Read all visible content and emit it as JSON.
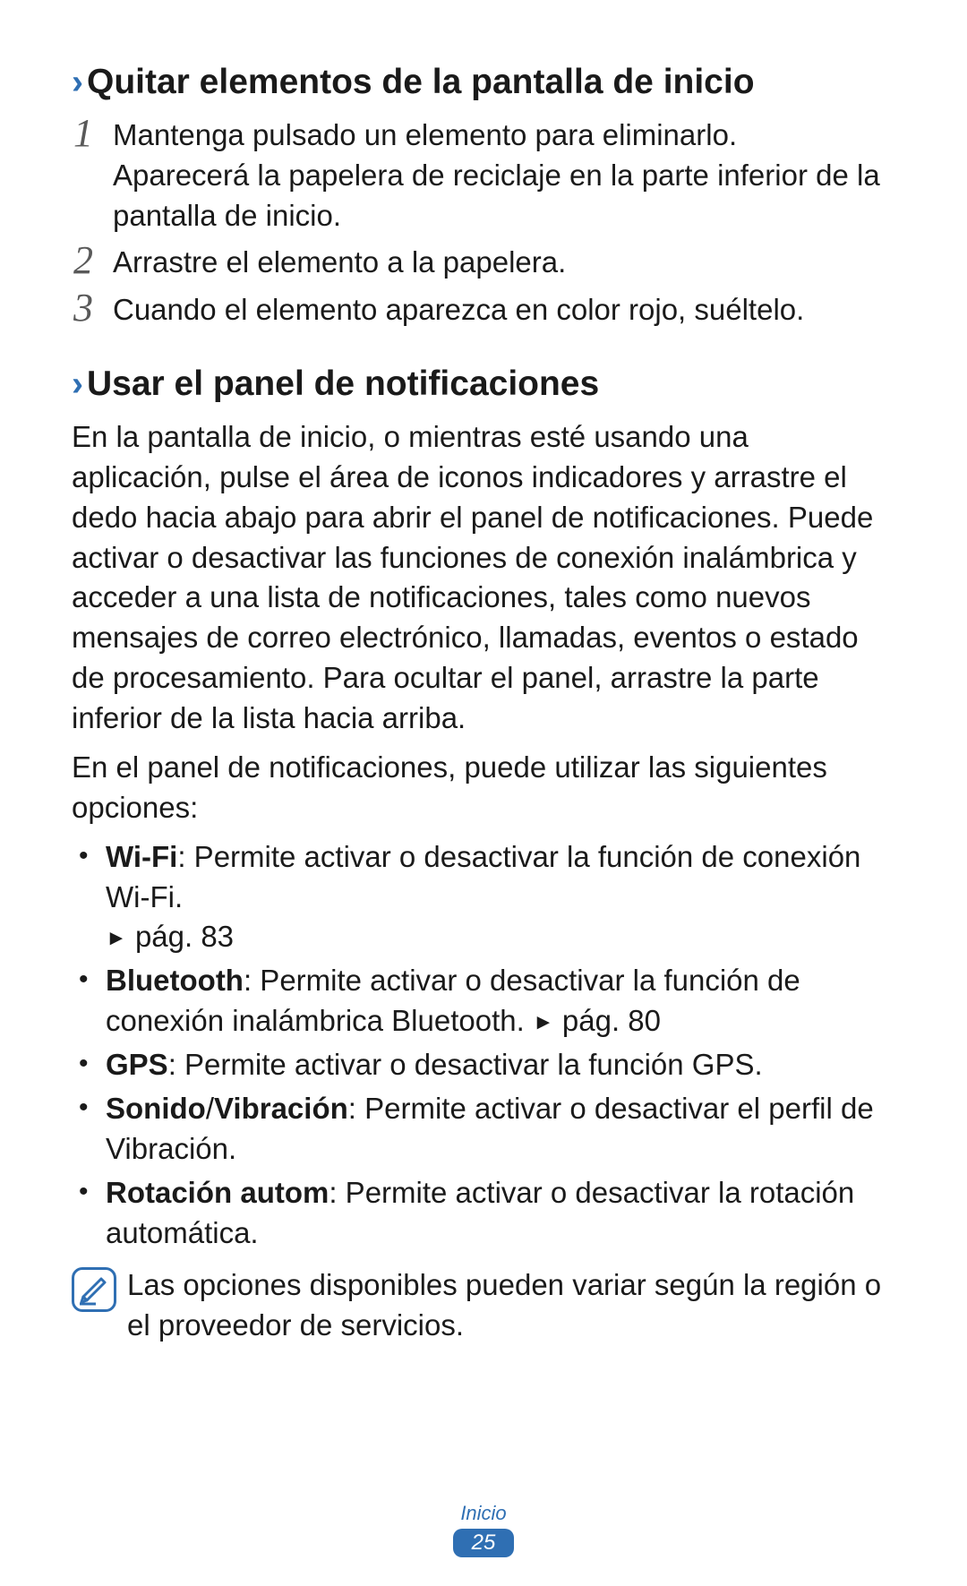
{
  "section1": {
    "heading": "Quitar elementos de la pantalla de inicio",
    "steps": [
      {
        "num": "1",
        "lines": [
          "Mantenga pulsado un elemento para eliminarlo.",
          "Aparecerá la papelera de reciclaje en la parte inferior de la pantalla de inicio."
        ]
      },
      {
        "num": "2",
        "lines": [
          "Arrastre el elemento a la papelera."
        ]
      },
      {
        "num": "3",
        "lines": [
          "Cuando el elemento aparezca en color rojo, suéltelo."
        ]
      }
    ]
  },
  "section2": {
    "heading": "Usar el panel de notificaciones",
    "para1": "En la pantalla de inicio, o mientras esté usando una aplicación, pulse el área de iconos indicadores y arrastre el dedo hacia abajo para abrir el panel de notificaciones. Puede activar o desactivar las funciones de conexión inalámbrica y acceder a una lista de notificaciones, tales como nuevos mensajes de correo electrónico, llamadas, eventos o estado de procesamiento. Para ocultar el panel, arrastre la parte inferior de la lista hacia arriba.",
    "para2": "En el panel de notificaciones, puede utilizar las siguientes opciones:",
    "bullets": {
      "b1_bold": "Wi-Fi",
      "b1_rest": ": Permite activar o desactivar la función de conexión Wi-Fi. ",
      "b1_ref": "pág. 83",
      "b2_bold": "Bluetooth",
      "b2_rest": ": Permite activar o desactivar la función de conexión inalámbrica Bluetooth. ",
      "b2_ref": "pág. 80",
      "b3_bold": "GPS",
      "b3_rest": ": Permite activar o desactivar la función GPS.",
      "b4_bold": "Sonido",
      "b4_slash": "/",
      "b4_bold2": "Vibración",
      "b4_rest": ": Permite activar o desactivar el perfil de Vibración.",
      "b5_bold": "Rotación autom",
      "b5_rest": ": Permite activar o desactivar la rotación automática."
    },
    "note": "Las opciones disponibles pueden variar según la región o el proveedor de servicios."
  },
  "footer": {
    "label": "Inicio",
    "page": "25"
  },
  "glyphs": {
    "chevron": "›",
    "bullet": "•",
    "triangle": "►"
  }
}
